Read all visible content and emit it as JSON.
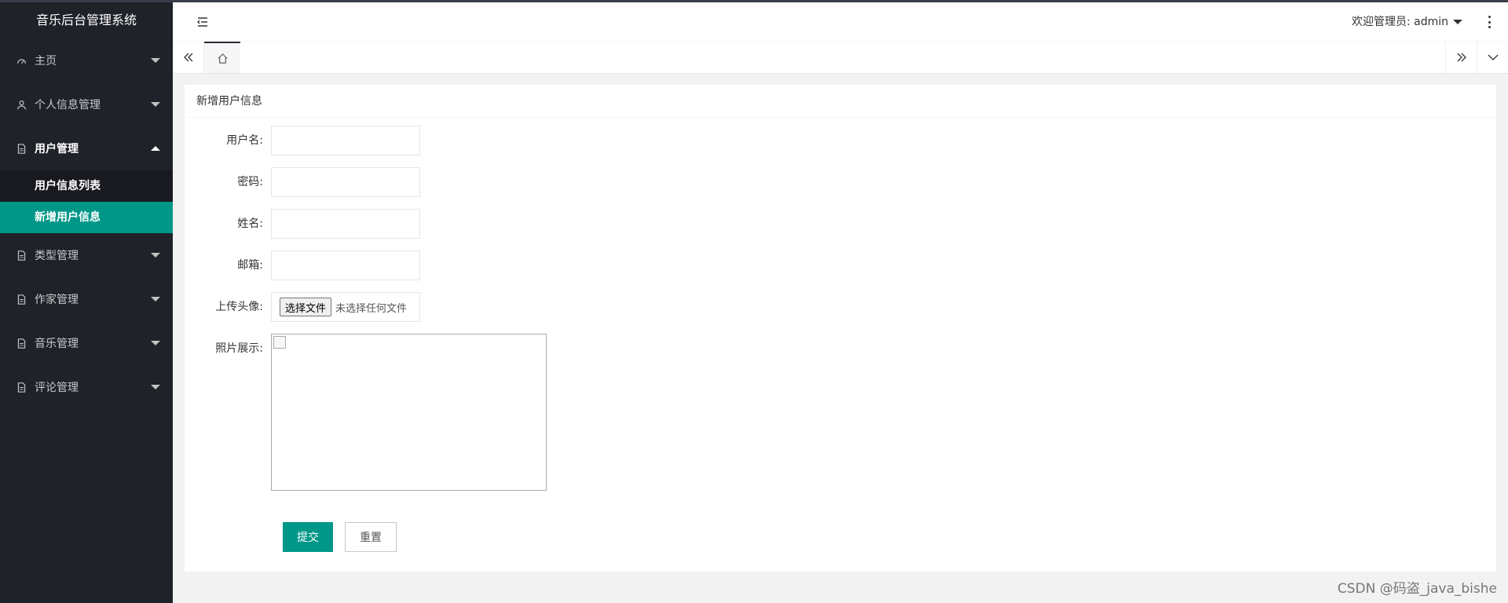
{
  "app": {
    "title": "音乐后台管理系统"
  },
  "sidebar": {
    "items": [
      {
        "label": "主页"
      },
      {
        "label": "个人信息管理"
      },
      {
        "label": "用户管理",
        "children": [
          {
            "label": "用户信息列表"
          },
          {
            "label": "新增用户信息"
          }
        ]
      },
      {
        "label": "类型管理"
      },
      {
        "label": "作家管理"
      },
      {
        "label": "音乐管理"
      },
      {
        "label": "评论管理"
      }
    ]
  },
  "header": {
    "welcome": "欢迎管理员: admin"
  },
  "card": {
    "title": "新增用户信息",
    "fields": {
      "username_label": "用户名:",
      "password_label": "密码:",
      "name_label": "姓名:",
      "email_label": "邮箱:",
      "avatar_label": "上传头像:",
      "photo_label": "照片展示:"
    },
    "file": {
      "button": "选择文件",
      "status": "未选择任何文件"
    },
    "buttons": {
      "submit": "提交",
      "reset": "重置"
    }
  },
  "watermark": "CSDN @码盗_java_bishe",
  "colors": {
    "sidebar_bg": "#20222a",
    "accent": "#009688",
    "page_bg": "#f2f2f2"
  }
}
